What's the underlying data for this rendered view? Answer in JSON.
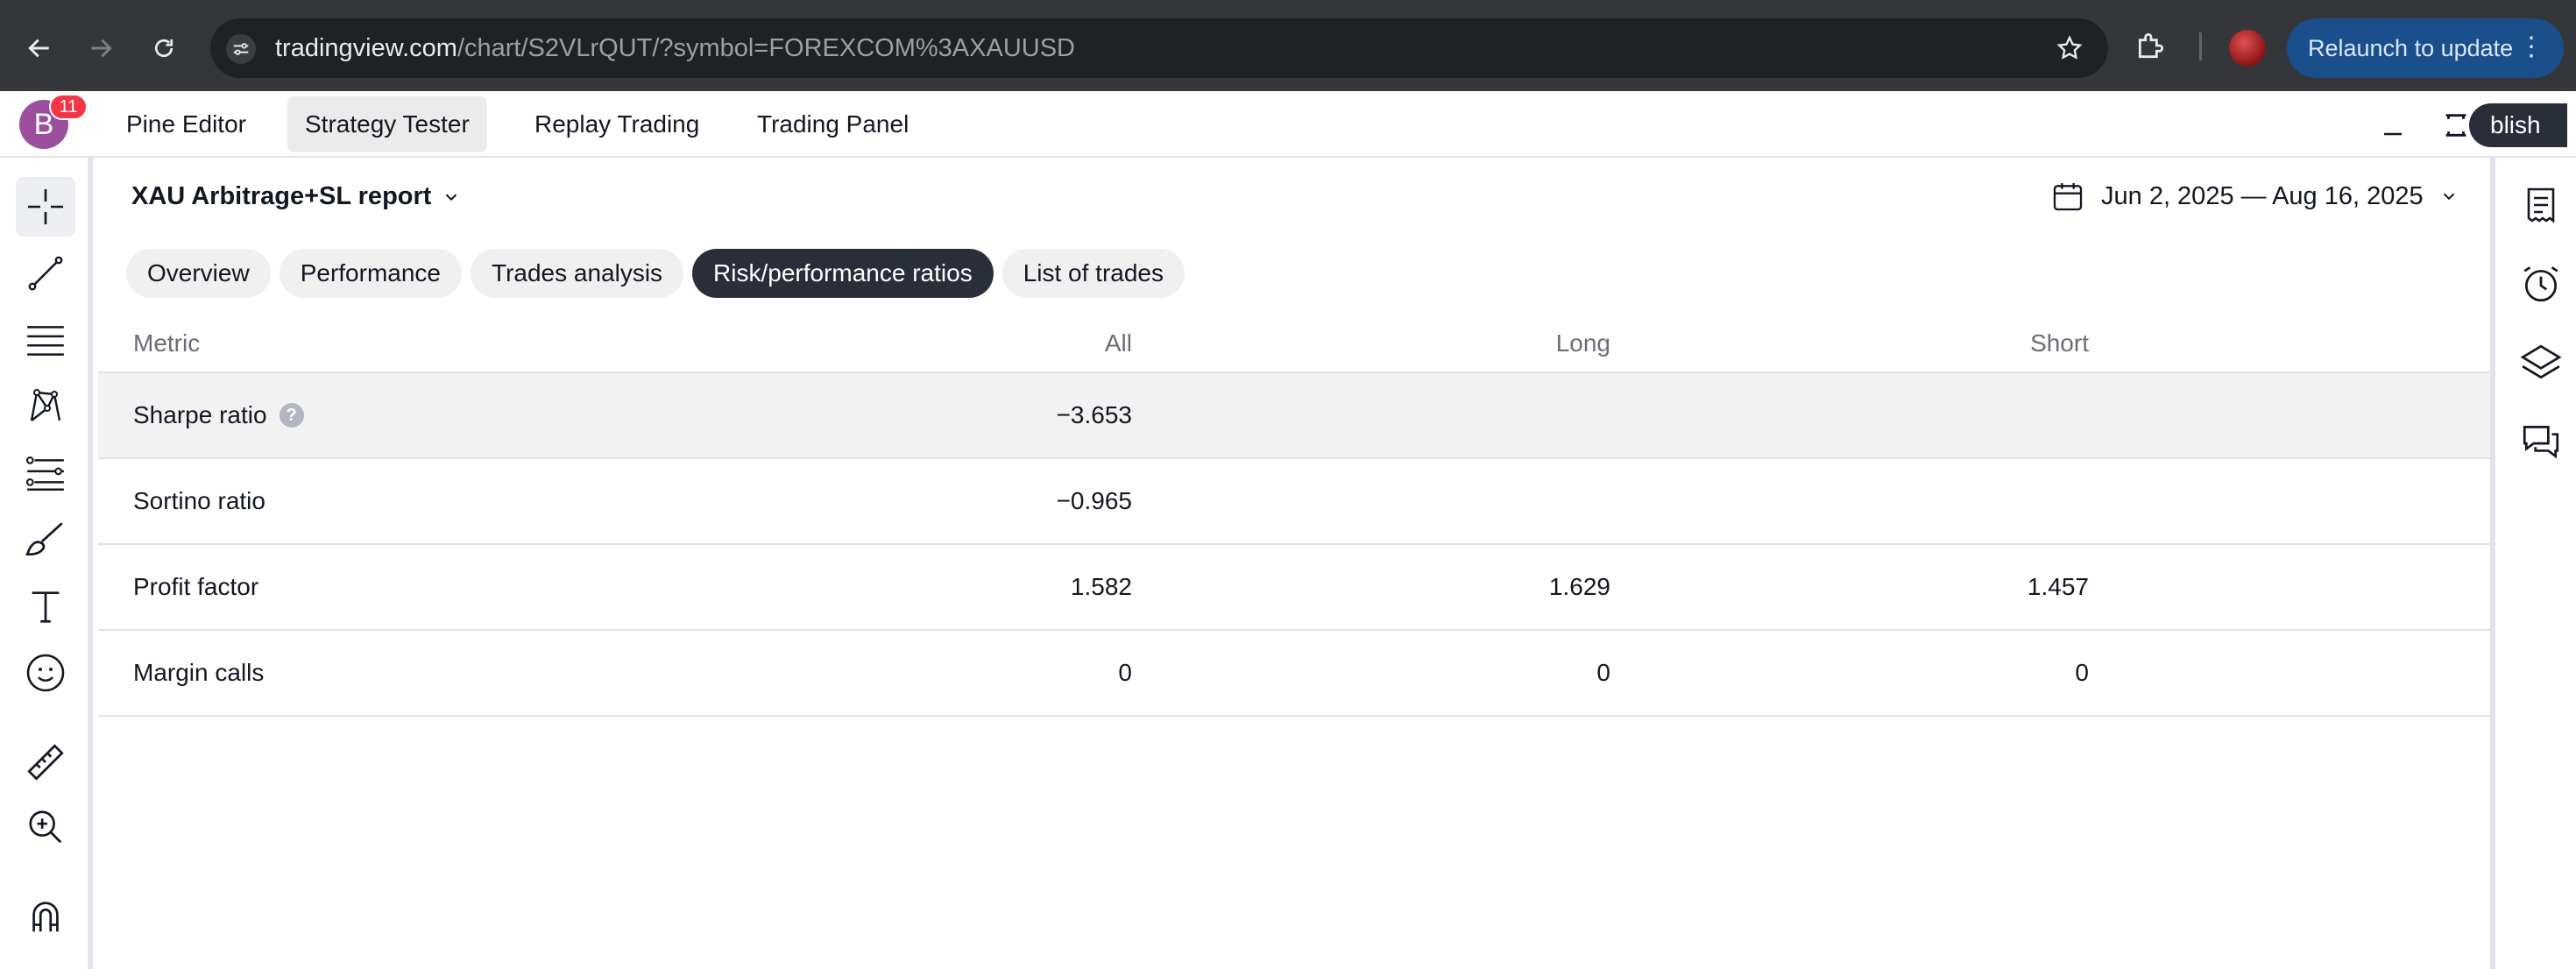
{
  "browser": {
    "url_host": "tradingview.com",
    "url_path": "/chart/S2VLrQUT/?symbol=FOREXCOM%3AXAUUSD",
    "relaunch_label": "Relaunch to update"
  },
  "appbar": {
    "avatar_letter": "B",
    "notification_count": "11",
    "tabs": [
      {
        "label": "Pine Editor",
        "active": false
      },
      {
        "label": "Strategy Tester",
        "active": true
      },
      {
        "label": "Replay Trading",
        "active": false
      },
      {
        "label": "Trading Panel",
        "active": false
      }
    ],
    "publish_label": "blish"
  },
  "report": {
    "title": "XAU Arbitrage+SL report",
    "date_range": "Jun 2, 2025 — Aug 16, 2025"
  },
  "subtabs": [
    {
      "label": "Overview",
      "active": false
    },
    {
      "label": "Performance",
      "active": false
    },
    {
      "label": "Trades analysis",
      "active": false
    },
    {
      "label": "Risk/performance ratios",
      "active": true
    },
    {
      "label": "List of trades",
      "active": false
    }
  ],
  "table": {
    "headers": {
      "metric": "Metric",
      "all": "All",
      "long": "Long",
      "short": "Short"
    },
    "rows": [
      {
        "metric": "Sharpe ratio",
        "all": "−3.653",
        "long": "",
        "short": "",
        "help": true
      },
      {
        "metric": "Sortino ratio",
        "all": "−0.965",
        "long": "",
        "short": "",
        "help": false
      },
      {
        "metric": "Profit factor",
        "all": "1.582",
        "long": "1.629",
        "short": "1.457",
        "help": false
      },
      {
        "metric": "Margin calls",
        "all": "0",
        "long": "0",
        "short": "0",
        "help": false
      }
    ]
  },
  "icons": {
    "left_toolbar": [
      "crosshair-icon",
      "trend-line-icon",
      "fib-retracement-icon",
      "pattern-icon",
      "forecast-icon",
      "brush-icon",
      "text-icon",
      "emoji-icon",
      "ruler-icon",
      "zoom-in-icon",
      "magnet-icon"
    ],
    "right_toolbar": [
      "watchlist-icon",
      "alarm-icon",
      "layers-icon",
      "chat-icon"
    ]
  },
  "colors": {
    "accent_dark": "#2a2e39",
    "notification": "#f23645",
    "relaunch": "#1a4f8b"
  }
}
